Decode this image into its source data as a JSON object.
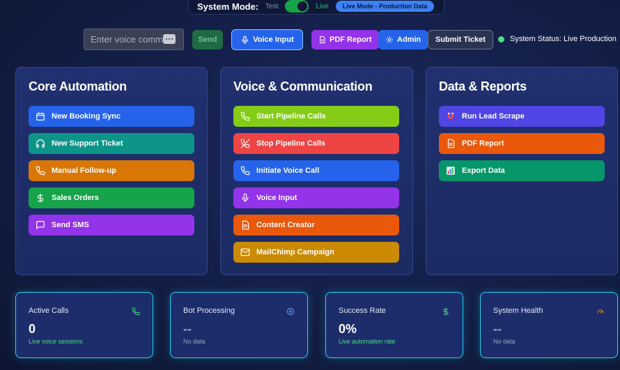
{
  "mode_panel": {
    "label": "System Mode:",
    "test_label": "Test",
    "live_label": "Live",
    "badge": "Live Mode - Production Data"
  },
  "toolbar": {
    "voice_placeholder": "Enter voice command...",
    "send_label": "Send",
    "voice_input_label": "Voice Input",
    "pdf_report_label": "PDF Report",
    "admin_label": "Admin",
    "submit_ticket_label": "Submit Ticket",
    "system_status": "System Status: Live Production"
  },
  "cards": [
    {
      "title": "Core Automation",
      "actions": [
        {
          "label": "New Booking Sync",
          "color": "#2563eb",
          "icon": "calendar-icon"
        },
        {
          "label": "New Support Ticket",
          "color": "#0d9488",
          "icon": "headphones-icon"
        },
        {
          "label": "Manual Follow-up",
          "color": "#d97706",
          "icon": "phone-icon"
        },
        {
          "label": "Sales Orders",
          "color": "#16a34a",
          "icon": "dollar-icon"
        },
        {
          "label": "Send SMS",
          "color": "#9333ea",
          "icon": "message-icon"
        }
      ]
    },
    {
      "title": "Voice & Communication",
      "actions": [
        {
          "label": "Start Pipeline Calls",
          "color": "#84cc16",
          "icon": "phone-icon"
        },
        {
          "label": "Stop Pipeline Calls",
          "color": "#ef4444",
          "icon": "phone-off-icon"
        },
        {
          "label": "Initiate Voice Call",
          "color": "#2563eb",
          "icon": "phone-icon"
        },
        {
          "label": "Voice Input",
          "color": "#9333ea",
          "icon": "mic-icon"
        },
        {
          "label": "Content Creator",
          "color": "#ea580c",
          "icon": "document-icon"
        },
        {
          "label": "MailChimp Campaign",
          "color": "#ca8a04",
          "icon": "mail-icon"
        }
      ]
    },
    {
      "title": "Data & Reports",
      "actions": [
        {
          "label": "Run Lead Scrape",
          "color": "#4f46e5",
          "icon": "magnet-icon"
        },
        {
          "label": "PDF Report",
          "color": "#ea580c",
          "icon": "document-icon"
        },
        {
          "label": "Export Data",
          "color": "#059669",
          "icon": "chart-icon"
        }
      ]
    }
  ],
  "stats": [
    {
      "title": "Active Calls",
      "value": "0",
      "sub": "Live voice sessions",
      "icon": "phone-icon",
      "icon_color": "#4ade80"
    },
    {
      "title": "Bot Processing",
      "value": "--",
      "sub": "No data",
      "icon": "robot-icon",
      "icon_color": "#60a5fa"
    },
    {
      "title": "Success Rate",
      "value": "0%",
      "sub": "Live automation rate",
      "icon": "dollar-icon",
      "icon_color": "#4ade80"
    },
    {
      "title": "System Health",
      "value": "--",
      "sub": "No data",
      "icon": "gauge-icon",
      "icon_color": "#f59e0b"
    }
  ]
}
